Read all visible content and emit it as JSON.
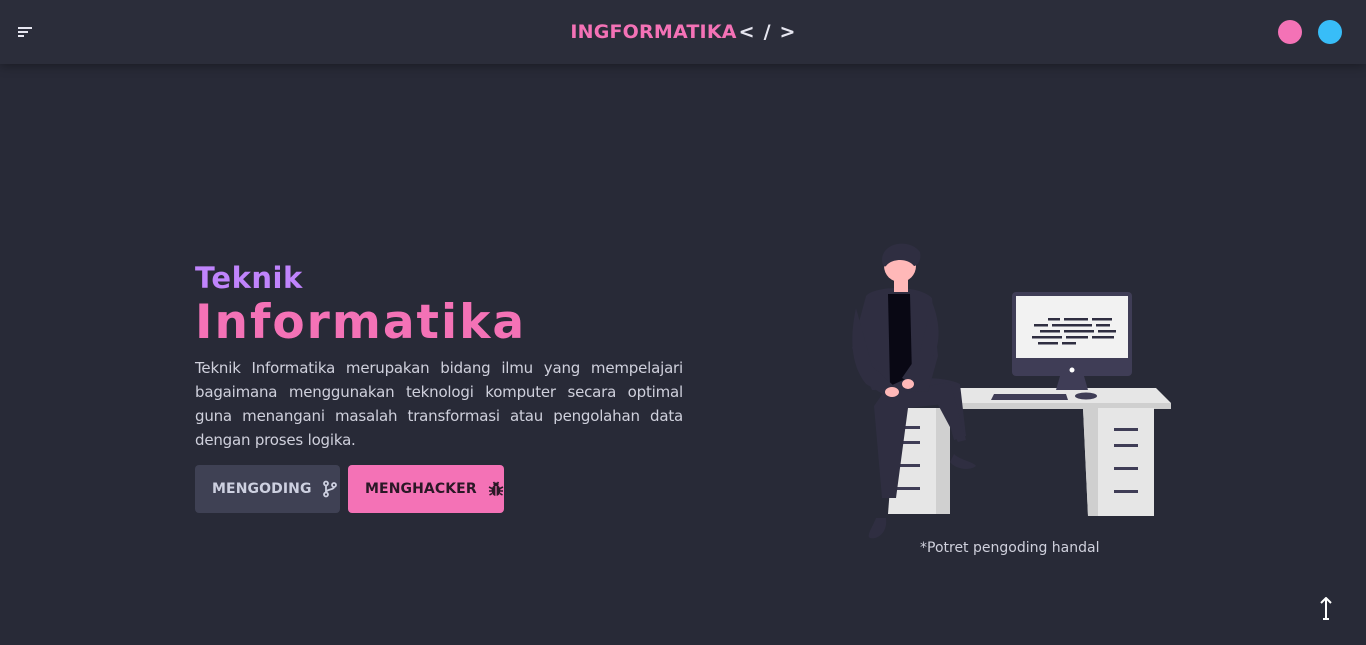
{
  "navbar": {
    "brand_name": "INGFORMATIKA",
    "brand_code": "< / >",
    "menu_icon": "menu-icon",
    "theme_colors": [
      "#f472b6",
      "#38bdf8"
    ]
  },
  "hero": {
    "kicker": "Teknik",
    "headline": "Informatika",
    "description": "Teknik Informatika merupakan bidang ilmu yang mempelajari bagaimana menggunakan teknologi komputer secara optimal guna menangani masalah transformasi atau pengolahan data dengan proses logika.",
    "buttons": {
      "code_label": "MENGODING",
      "code_icon": "git-branch-icon",
      "hack_label": "MENGHACKER",
      "hack_icon": "bug-icon"
    }
  },
  "illustration": {
    "caption": "*Potret pengoding handal"
  },
  "scroll_top": {
    "icon": "arrow-up-icon"
  },
  "colors": {
    "background": "#282a37",
    "accent": "#f472b6",
    "secondary": "#c084fc"
  }
}
